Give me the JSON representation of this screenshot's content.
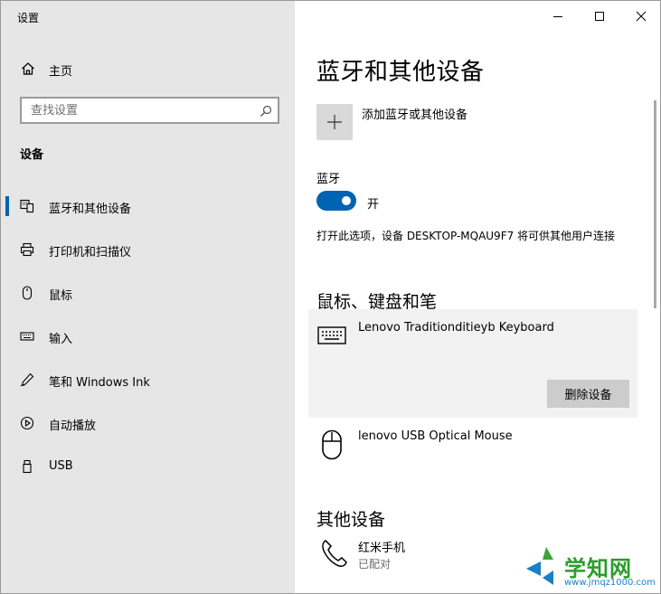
{
  "window": {
    "title": "设置"
  },
  "sidebar": {
    "home_label": "主页",
    "search": {
      "placeholder": "查找设置"
    },
    "section_title": "设备",
    "items": [
      {
        "label": "蓝牙和其他设备",
        "icon": "bluetooth-devices-icon",
        "active": true
      },
      {
        "label": "打印机和扫描仪",
        "icon": "printer-icon"
      },
      {
        "label": "鼠标",
        "icon": "mouse-icon"
      },
      {
        "label": "输入",
        "icon": "keyboard-icon"
      },
      {
        "label": "笔和 Windows Ink",
        "icon": "pen-icon"
      },
      {
        "label": "自动播放",
        "icon": "autoplay-icon"
      },
      {
        "label": "USB",
        "icon": "usb-icon"
      }
    ]
  },
  "main": {
    "title": "蓝牙和其他设备",
    "add_device_label": "添加蓝牙或其他设备",
    "bluetooth": {
      "label": "蓝牙",
      "state_label": "开",
      "on": true,
      "description": "打开此选项，设备 DESKTOP-MQAU9F7 将可供其他用户连接"
    },
    "mouse_keyboard_pen": {
      "title": "鼠标、键盘和笔",
      "devices": [
        {
          "name": "Lenovo Traditionditieyb Keyboard",
          "icon": "keyboard-icon",
          "remove_label": "删除设备"
        },
        {
          "name": "lenovo USB Optical Mouse",
          "icon": "mouse-icon"
        }
      ]
    },
    "other_devices": {
      "title": "其他设备",
      "devices": [
        {
          "name": "红米手机",
          "status": "已配对",
          "icon": "phone-icon"
        }
      ]
    }
  },
  "watermark": {
    "text": "学知网",
    "url": "www.jmqz1000.com"
  },
  "colors": {
    "accent": "#0063b1",
    "sidebar_bg": "#e6e6e6",
    "card_bg": "#f2f2f2"
  }
}
